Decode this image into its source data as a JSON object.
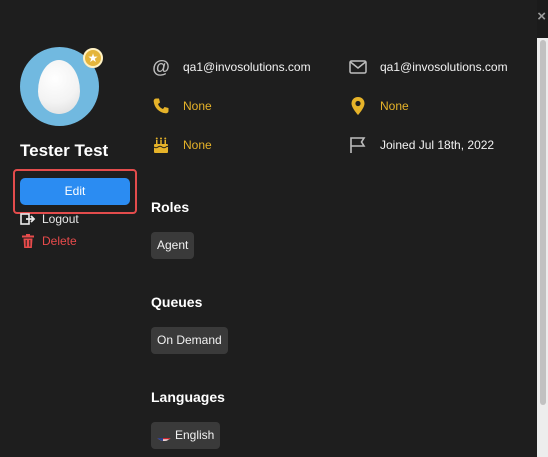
{
  "window": {
    "close_symbol": "×"
  },
  "profile": {
    "name": "Tester Test",
    "edit_label": "Edit",
    "logout_label": "Logout",
    "delete_label": "Delete",
    "badge_icon": "star-badge-icon"
  },
  "info": {
    "email_primary": "qa1@invosolutions.com",
    "email_secondary": "qa1@invosolutions.com",
    "phone": "None",
    "location": "None",
    "birthday": "None",
    "joined": "Joined Jul 18th, 2022"
  },
  "sections": {
    "roles": {
      "title": "Roles",
      "items": [
        "Agent"
      ]
    },
    "queues": {
      "title": "Queues",
      "items": [
        "On Demand"
      ]
    },
    "languages": {
      "title": "Languages",
      "items": [
        "English"
      ]
    }
  },
  "colors": {
    "background": "#1e1e1e",
    "accent_blue": "#2b8cf2",
    "highlight_red": "#e34c4c",
    "info_yellow": "#e6b329",
    "delete_red": "#e84b4b",
    "chip_bg": "#3a3a3a"
  }
}
